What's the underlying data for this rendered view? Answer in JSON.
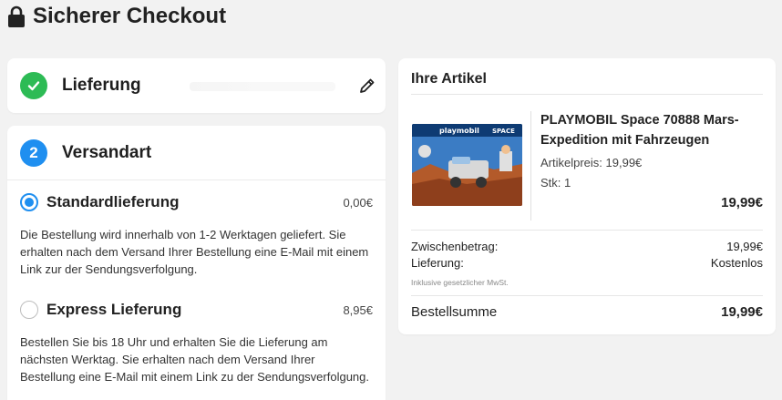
{
  "header": {
    "title": "Sicherer Checkout",
    "icon": "lock-icon"
  },
  "delivery": {
    "step_title": "Lieferung",
    "status_icon": "check-icon",
    "edit_icon": "pencil-icon"
  },
  "shipping": {
    "step_number": "2",
    "step_title": "Versandart",
    "options": [
      {
        "label": "Standardlieferung",
        "price": "0,00€",
        "selected": true,
        "description": "Die Bestellung wird innerhalb von 1-2 Werktagen geliefert. Sie erhalten nach dem Versand Ihrer Bestellung eine E-Mail mit einem Link zur der Sendungsverfolgung."
      },
      {
        "label": "Express Lieferung",
        "price": "8,95€",
        "selected": false,
        "description": "Bestellen Sie bis 18 Uhr und erhalten Sie die Lieferung am nächsten Werktag. Sie erhalten nach dem Versand Ihrer Bestellung eine E-Mail mit einem Link zu der Sendungsverfolgung."
      }
    ]
  },
  "items": {
    "title": "Ihre Artikel",
    "product": {
      "name": "PLAYMOBIL Space 70888 Mars-Expedition mit Fahrzeugen",
      "unit_price": "Artikelpreis: 19,99€",
      "quantity": "Stk: 1",
      "total": "19,99€",
      "image_brand": "playmobil",
      "image_badge": "SPACE"
    },
    "summary": {
      "subtotal_label": "Zwischenbetrag:",
      "subtotal_value": "19,99€",
      "shipping_label": "Lieferung:",
      "shipping_value": "Kostenlos",
      "vat_note": "Inklusive gesetzlicher MwSt.",
      "total_label": "Bestellsumme",
      "total_value": "19,99€"
    }
  },
  "colors": {
    "success": "#2dbb55",
    "accent": "#1f8ff0",
    "background": "#f2f2f2"
  }
}
